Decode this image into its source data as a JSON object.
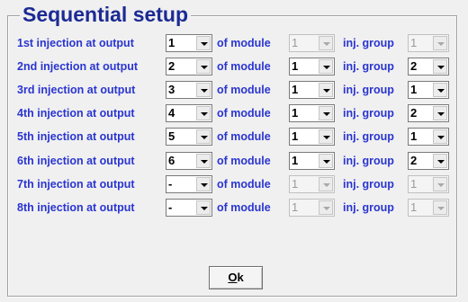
{
  "title": "Sequential setup",
  "rows": [
    {
      "label": "1st injection at  output",
      "output": "1",
      "module_label": "of module",
      "module": "1",
      "module_enabled": false,
      "group_label": "inj. group",
      "group": "1",
      "group_enabled": false
    },
    {
      "label": "2nd injection at  output",
      "output": "2",
      "module_label": "of module",
      "module": "1",
      "module_enabled": true,
      "group_label": "inj. group",
      "group": "2",
      "group_enabled": true
    },
    {
      "label": "3rd injection at  output",
      "output": "3",
      "module_label": "of module",
      "module": "1",
      "module_enabled": true,
      "group_label": "inj. group",
      "group": "1",
      "group_enabled": true
    },
    {
      "label": "4th injection at  output",
      "output": "4",
      "module_label": "of module",
      "module": "1",
      "module_enabled": true,
      "group_label": "inj. group",
      "group": "2",
      "group_enabled": true
    },
    {
      "label": "5th injection at  output",
      "output": "5",
      "module_label": "of module",
      "module": "1",
      "module_enabled": true,
      "group_label": "inj. group",
      "group": "1",
      "group_enabled": true
    },
    {
      "label": "6th injection at  output",
      "output": "6",
      "module_label": "of module",
      "module": "1",
      "module_enabled": true,
      "group_label": "inj. group",
      "group": "2",
      "group_enabled": true
    },
    {
      "label": "7th injection at  output",
      "output": "-",
      "module_label": "of module",
      "module": "1",
      "module_enabled": false,
      "group_label": "inj. group",
      "group": "1",
      "group_enabled": false
    },
    {
      "label": "8th injection at  output",
      "output": "-",
      "module_label": "of module",
      "module": "1",
      "module_enabled": false,
      "group_label": "inj. group",
      "group": "1",
      "group_enabled": false
    }
  ],
  "ok_button": {
    "label_accel": "O",
    "label_rest": "k"
  }
}
